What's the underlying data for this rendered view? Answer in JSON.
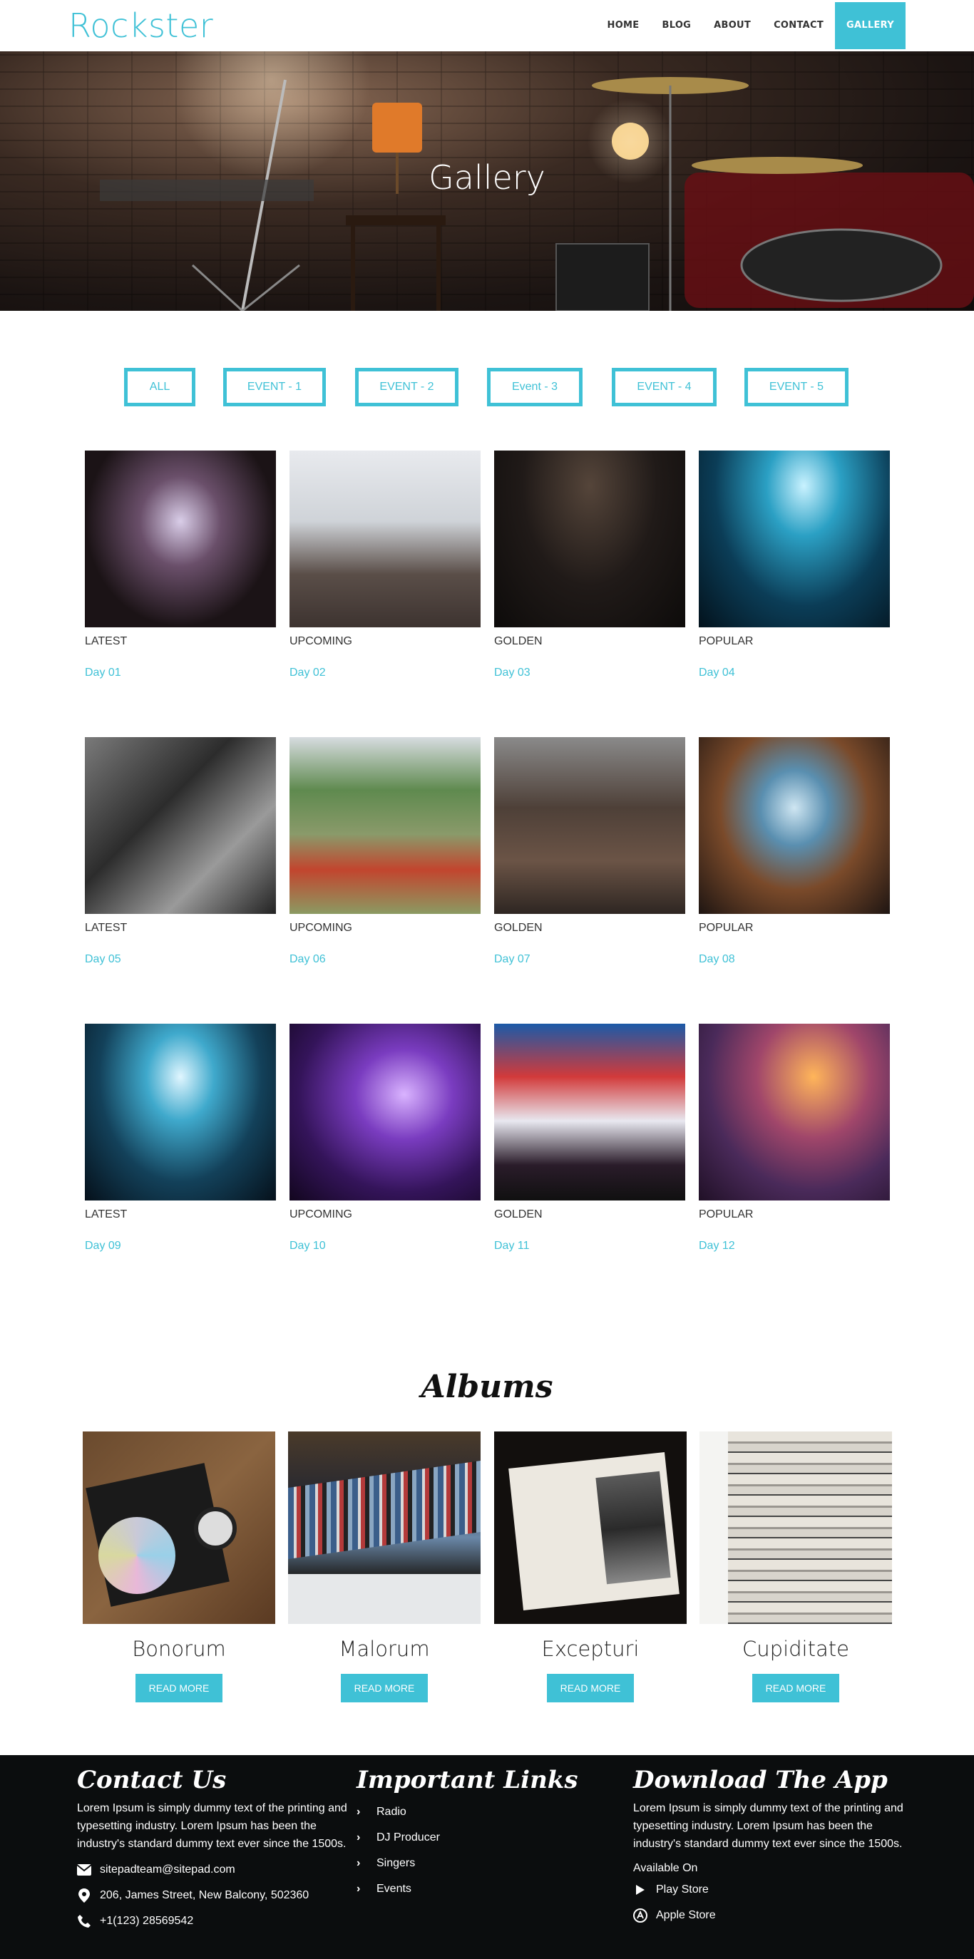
{
  "header": {
    "logo": "Rockster",
    "nav": [
      {
        "label": "HOME",
        "active": false
      },
      {
        "label": "BLOG",
        "active": false
      },
      {
        "label": "ABOUT",
        "active": false
      },
      {
        "label": "CONTACT",
        "active": false
      },
      {
        "label": "GALLERY",
        "active": true
      }
    ]
  },
  "banner": {
    "title": "Gallery"
  },
  "filters": [
    "ALL",
    "EVENT - 1",
    "EVENT - 2",
    "Event - 3",
    "EVENT - 4",
    "EVENT - 5"
  ],
  "gallery": [
    {
      "category": "LATEST",
      "day": "Day 01"
    },
    {
      "category": "UPCOMING",
      "day": "Day 02"
    },
    {
      "category": "GOLDEN",
      "day": "Day 03"
    },
    {
      "category": "POPULAR",
      "day": "Day 04"
    },
    {
      "category": "LATEST",
      "day": "Day 05"
    },
    {
      "category": "UPCOMING",
      "day": "Day 06"
    },
    {
      "category": "GOLDEN",
      "day": "Day 07"
    },
    {
      "category": "POPULAR",
      "day": "Day 08"
    },
    {
      "category": "LATEST",
      "day": "Day 09"
    },
    {
      "category": "UPCOMING",
      "day": "Day 10"
    },
    {
      "category": "GOLDEN",
      "day": "Day 11"
    },
    {
      "category": "POPULAR",
      "day": "Day 12"
    }
  ],
  "albums": {
    "title": "Albums",
    "items": [
      {
        "name": "Bonorum",
        "button": "READ MORE"
      },
      {
        "name": "Malorum",
        "button": "READ MORE"
      },
      {
        "name": "Excepturi",
        "button": "READ MORE"
      },
      {
        "name": "Cupiditate",
        "button": "READ MORE"
      }
    ]
  },
  "footer": {
    "contact": {
      "title": "Contact Us",
      "text": "Lorem Ipsum is simply dummy text of the printing and typesetting industry. Lorem Ipsum has been the industry's standard dummy text ever since the 1500s.",
      "email": "sitepadteam@sitepad.com",
      "address": "206, James Street, New Balcony, 502360",
      "phone": "+1(123) 28569542"
    },
    "links": {
      "title": "Important Links",
      "items": [
        "Radio",
        "DJ Producer",
        "Singers",
        "Events"
      ]
    },
    "app": {
      "title": "Download The App",
      "text": "Lorem Ipsum is simply dummy text of the printing and typesetting industry. Lorem Ipsum has been the industry's standard dummy text ever since the 1500s.",
      "available": "Available On",
      "play_store": "Play Store",
      "apple_store": "Apple Store"
    }
  },
  "colors": {
    "accent": "#3fc1d6",
    "footer_bg": "#0b0d0e"
  }
}
